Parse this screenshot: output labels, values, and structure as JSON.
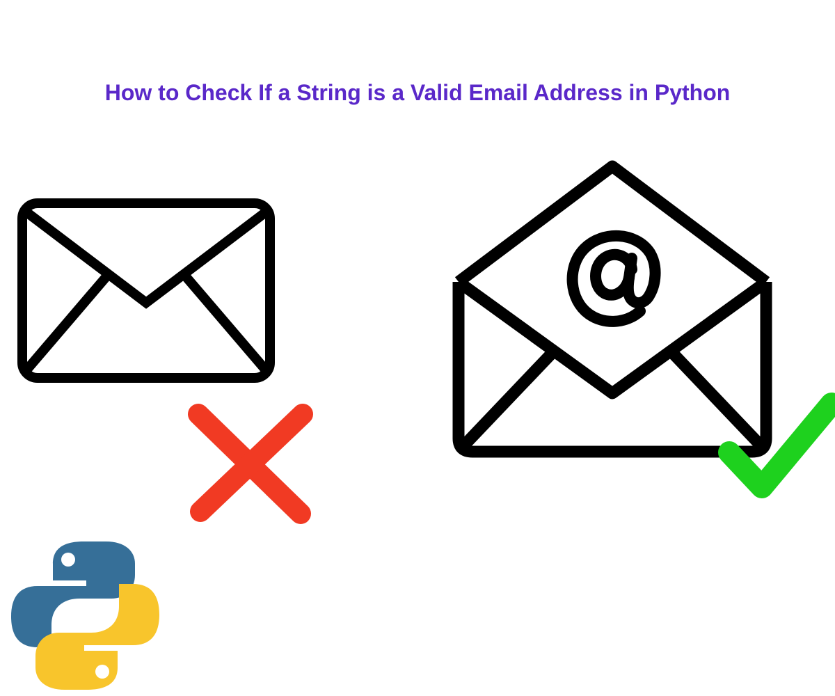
{
  "title": "How to Check If a String is a Valid Email Address in Python",
  "icons": {
    "closed_envelope": "closed-envelope-icon",
    "open_envelope": "open-envelope-at-icon",
    "cross": "cross-mark-icon",
    "check": "check-mark-icon",
    "python": "python-logo-icon"
  },
  "colors": {
    "title": "#5a28c9",
    "cross": "#f13a23",
    "check": "#1ed11e",
    "envelope_stroke": "#000000",
    "python_blue": "#366f98",
    "python_yellow": "#f8c52c"
  }
}
